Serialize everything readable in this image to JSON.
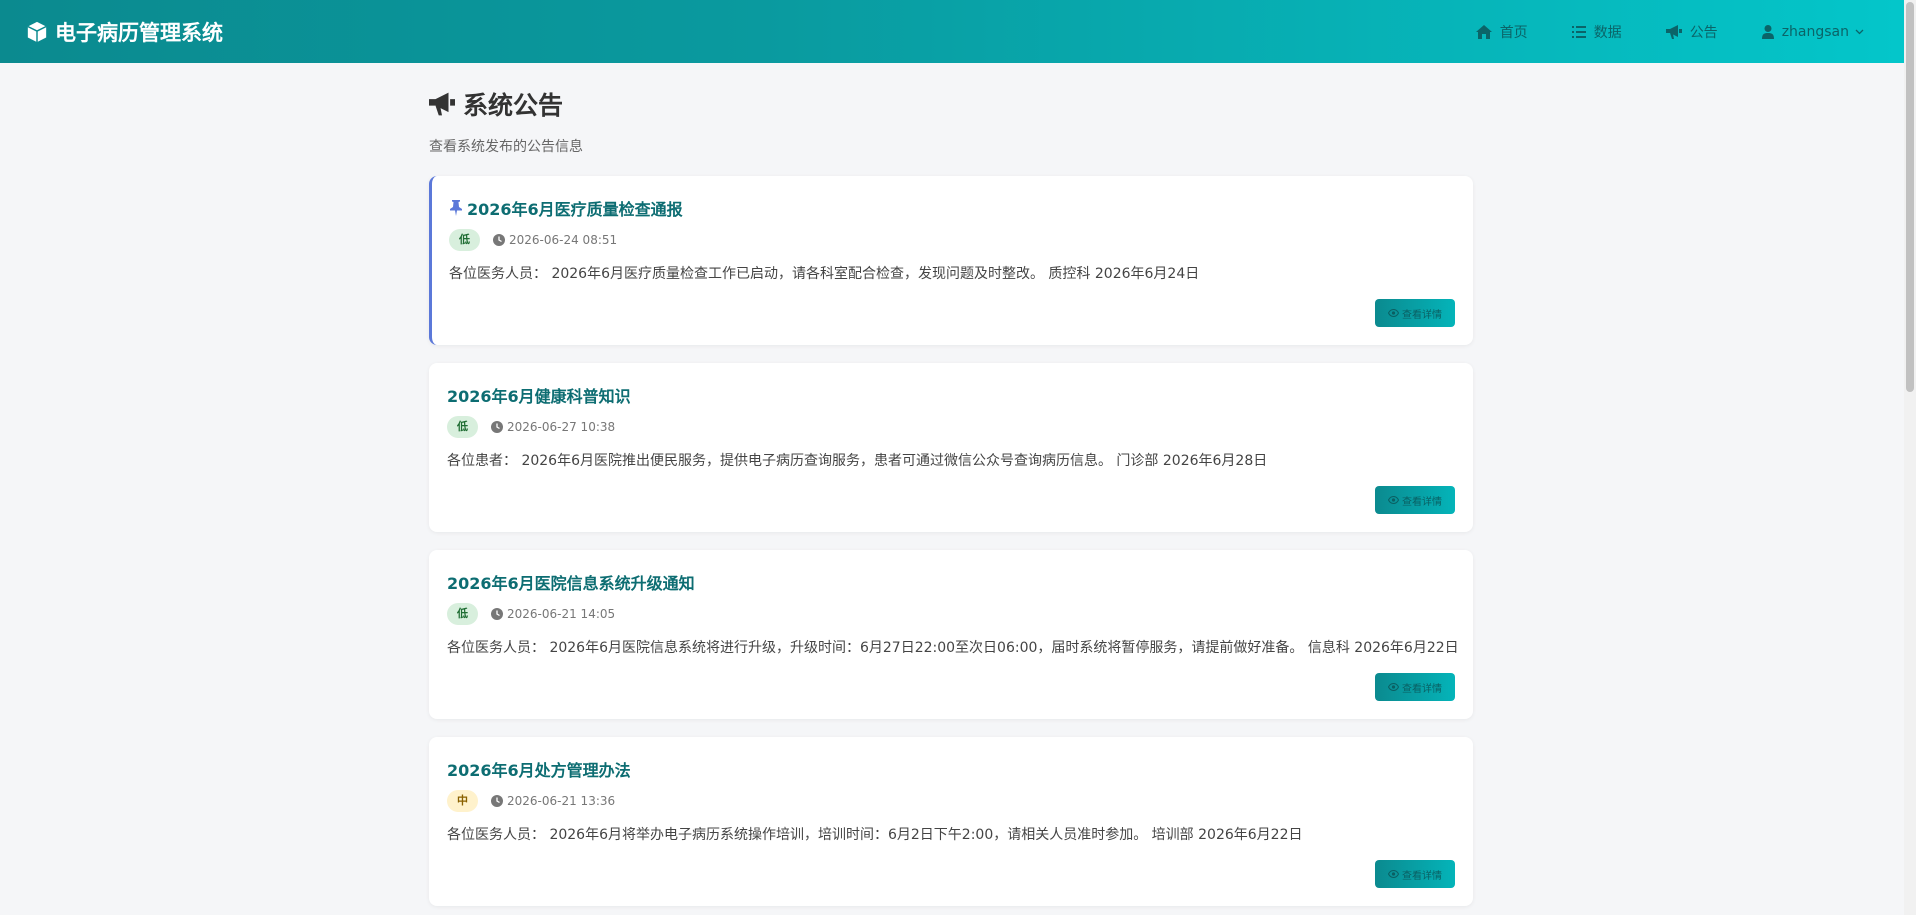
{
  "brand": {
    "title": "电子病历管理系统",
    "icon": "cube-icon"
  },
  "nav": {
    "home": "首页",
    "data": "数据",
    "notice": "公告",
    "user": "zhangsan"
  },
  "page": {
    "title": "系统公告",
    "subtitle": "查看系统发布的公告信息"
  },
  "detail_label": "查看详情",
  "colors": {
    "accent": "#0b8a8f",
    "pinned_border": "#5b78d9",
    "title_text": "#0d6d72"
  },
  "announcements": [
    {
      "pinned": true,
      "title": "2026年6月医疗质量检查通报",
      "priority": "低",
      "time": "2026-06-24 08:51",
      "content": "各位医务人员： 2026年6月医疗质量检查工作已启动，请各科室配合检查，发现问题及时整改。 质控科 2026年6月24日"
    },
    {
      "pinned": false,
      "title": "2026年6月健康科普知识",
      "priority": "低",
      "time": "2026-06-27 10:38",
      "content": "各位患者： 2026年6月医院推出便民服务，提供电子病历查询服务，患者可通过微信公众号查询病历信息。 门诊部 2026年6月28日"
    },
    {
      "pinned": false,
      "title": "2026年6月医院信息系统升级通知",
      "priority": "低",
      "time": "2026-06-21 14:05",
      "content": "各位医务人员： 2026年6月医院信息系统将进行升级，升级时间：6月27日22:00至次日06:00，届时系统将暂停服务，请提前做好准备。 信息科 2026年6月22日"
    },
    {
      "pinned": false,
      "title": "2026年6月处方管理办法",
      "priority": "中",
      "time": "2026-06-21 13:36",
      "content": "各位医务人员： 2026年6月将举办电子病历系统操作培训，培训时间：6月2日下午2:00，请相关人员准时参加。 培训部 2026年6月22日"
    }
  ]
}
